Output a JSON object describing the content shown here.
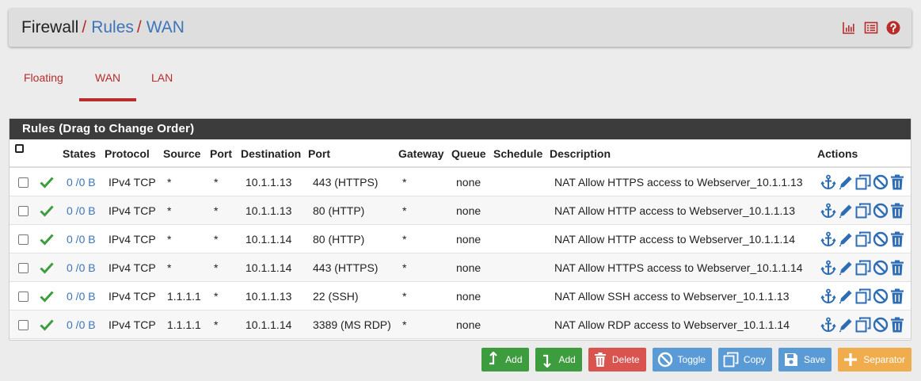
{
  "breadcrumb": {
    "root": "Firewall",
    "sep": "/",
    "level1": "Rules",
    "level2": "WAN"
  },
  "header_icons": [
    "chart-icon",
    "list-icon",
    "help-icon"
  ],
  "tabs": [
    {
      "label": "Floating",
      "active": false
    },
    {
      "label": "WAN",
      "active": true
    },
    {
      "label": "LAN",
      "active": false
    }
  ],
  "panel": {
    "title": "Rules (Drag to Change Order)"
  },
  "columns": [
    "States",
    "Protocol",
    "Source",
    "Port",
    "Destination",
    "Port",
    "Gateway",
    "Queue",
    "Schedule",
    "Description",
    "Actions"
  ],
  "rows": [
    {
      "states": "0 /0 B",
      "protocol": "IPv4 TCP",
      "source": "*",
      "sport": "*",
      "dest": "10.1.1.13",
      "dport": "443 (HTTPS)",
      "gateway": "*",
      "queue": "none",
      "schedule": "",
      "description": "NAT Allow HTTPS access to Webserver_10.1.1.13"
    },
    {
      "states": "0 /0 B",
      "protocol": "IPv4 TCP",
      "source": "*",
      "sport": "*",
      "dest": "10.1.1.13",
      "dport": "80 (HTTP)",
      "gateway": "*",
      "queue": "none",
      "schedule": "",
      "description": "NAT Allow HTTP access to Webserver_10.1.1.13"
    },
    {
      "states": "0 /0 B",
      "protocol": "IPv4 TCP",
      "source": "*",
      "sport": "*",
      "dest": "10.1.1.14",
      "dport": "80 (HTTP)",
      "gateway": "*",
      "queue": "none",
      "schedule": "",
      "description": "NAT Allow HTTP access to Webserver_10.1.1.14"
    },
    {
      "states": "0 /0 B",
      "protocol": "IPv4 TCP",
      "source": "*",
      "sport": "*",
      "dest": "10.1.1.14",
      "dport": "443 (HTTPS)",
      "gateway": "*",
      "queue": "none",
      "schedule": "",
      "description": "NAT Allow HTTPS access to Webserver_10.1.1.14"
    },
    {
      "states": "0 /0 B",
      "protocol": "IPv4 TCP",
      "source": "1.1.1.1",
      "sport": "*",
      "dest": "10.1.1.13",
      "dport": "22 (SSH)",
      "gateway": "*",
      "queue": "none",
      "schedule": "",
      "description": "NAT Allow SSH access to Webserver_10.1.1.13"
    },
    {
      "states": "0 /0 B",
      "protocol": "IPv4 TCP",
      "source": "1.1.1.1",
      "sport": "*",
      "dest": "10.1.1.14",
      "dport": "3389 (MS RDP)",
      "gateway": "*",
      "queue": "none",
      "schedule": "",
      "description": "NAT Allow RDP access to Webserver_10.1.1.14"
    }
  ],
  "buttons": {
    "add_top": "Add",
    "add_bottom": "Add",
    "delete": "Delete",
    "toggle": "Toggle",
    "copy": "Copy",
    "save": "Save",
    "separator": "Separator"
  },
  "colors": {
    "accent_red": "#b82c2c",
    "link_blue": "#3c75b8",
    "pass_green": "#3d9c3d",
    "panel_head": "#3c3c3c"
  }
}
